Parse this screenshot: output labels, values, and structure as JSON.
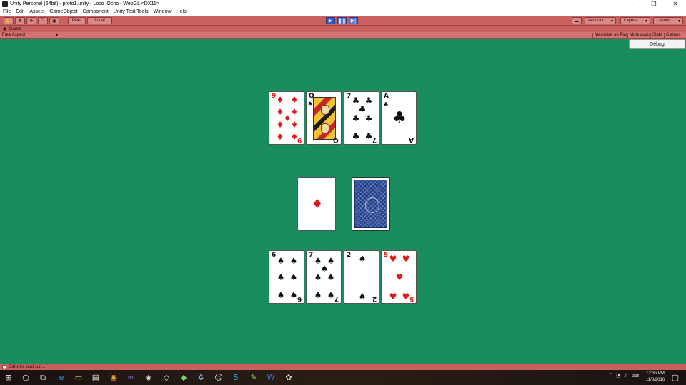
{
  "window": {
    "title": "Unity Personal (64bit) - proto1.unity - Loco_Ocho - WebGL <DX11>",
    "controls": [
      "–",
      "❐",
      "✕"
    ]
  },
  "menu": [
    "File",
    "Edit",
    "Assets",
    "GameObject",
    "Component",
    "Unity Test Tools",
    "Window",
    "Help"
  ],
  "toolbar": {
    "pivot_label": "Pivot",
    "local_label": "Local",
    "account_label": "Account",
    "layers_label": "Layers",
    "layout_label": "Layout"
  },
  "game_tab": {
    "label": "Game",
    "aspect": "Free Aspect",
    "maximize_label": "Maximize on Play",
    "mute_label": "Mute audio",
    "stats_label": "Stats",
    "gizmos_label": "Gizmos"
  },
  "debug_button": "Debug",
  "cards": {
    "top_row": [
      {
        "rank": "9",
        "suit": "♦",
        "color": "red"
      },
      {
        "rank": "Q",
        "suit": "♠",
        "color": "black",
        "face": true
      },
      {
        "rank": "7",
        "suit": "♣",
        "color": "black"
      },
      {
        "rank": "A",
        "suit": "♣",
        "color": "black"
      }
    ],
    "discard": {
      "suit": "♦",
      "color": "red"
    },
    "bottom_row": [
      {
        "rank": "6",
        "suit": "♠",
        "color": "black"
      },
      {
        "rank": "7",
        "suit": "♠",
        "color": "black"
      },
      {
        "rank": "2",
        "suit": "♠",
        "color": "black"
      },
      {
        "rank": "5",
        "suit": "♥",
        "color": "red"
      }
    ]
  },
  "status": {
    "message": "Get wild card suit..."
  },
  "taskbar": {
    "time": "12:35 PM",
    "date": "11/8/2016"
  },
  "colors": {
    "table_felt": "#1b8c5e",
    "play_mode_tint": "#c86060",
    "red_suit": "#e01818"
  }
}
